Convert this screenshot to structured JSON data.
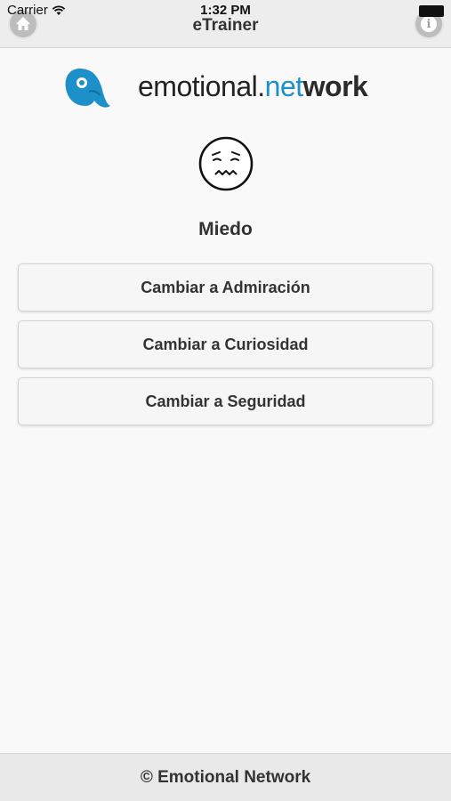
{
  "status_bar": {
    "carrier": "Carrier",
    "time": "1:32 PM"
  },
  "nav": {
    "title": "eTrainer",
    "left_icon": "home-icon",
    "right_icon": "info-icon",
    "info_glyph": "i"
  },
  "logo": {
    "text_part1": "emotional.",
    "text_part2": "net",
    "text_part3": "work",
    "mark_color": "#1d8fc9"
  },
  "emotion": {
    "icon": "worried-face-icon",
    "name": "Miedo"
  },
  "actions": [
    {
      "label": "Cambiar a Admiración"
    },
    {
      "label": "Cambiar a Curiosidad"
    },
    {
      "label": "Cambiar a Seguridad"
    }
  ],
  "footer": {
    "text": "© Emotional Network"
  },
  "colors": {
    "accent": "#1d8fc9",
    "background": "#f9f9f9",
    "bar": "#ededed"
  }
}
